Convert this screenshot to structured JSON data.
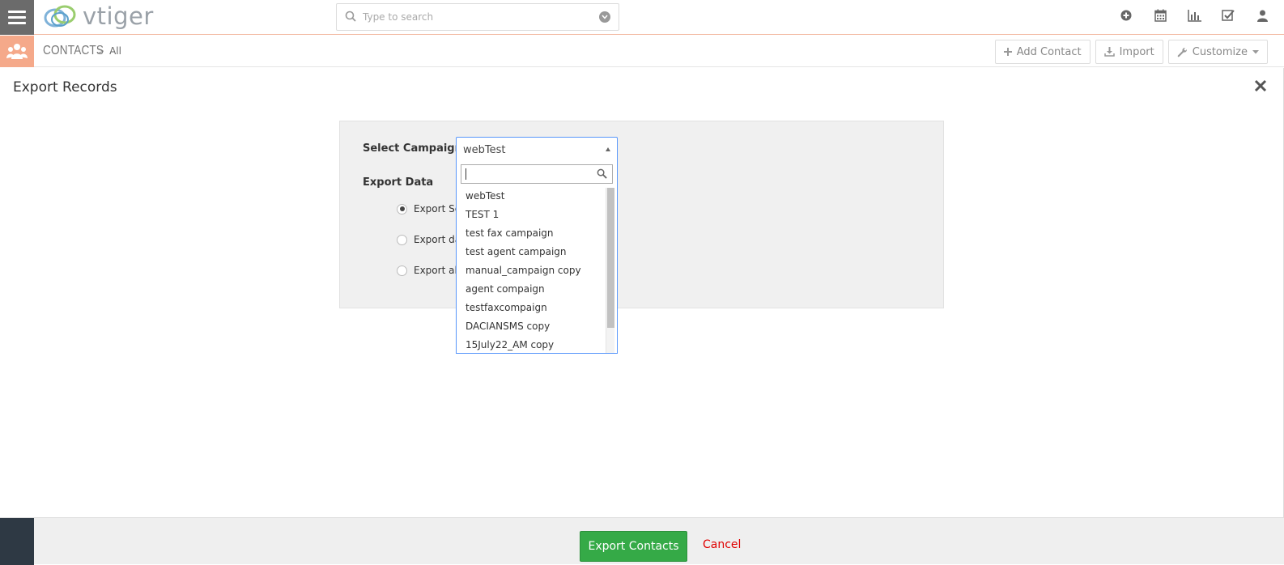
{
  "app": {
    "logo_text": "vtiger"
  },
  "search": {
    "placeholder": "Type to search"
  },
  "top_icons": [
    "plus-circle-icon",
    "calendar-icon",
    "bar-chart-icon",
    "checkbox-icon",
    "user-icon"
  ],
  "module_bar": {
    "module": "CONTACTS",
    "separator": ">",
    "view": "All",
    "actions": {
      "add": "Add Contact",
      "import": "Import",
      "customize": "Customize"
    }
  },
  "modal": {
    "title": "Export Records",
    "select_campaign_label": "Select Campaign",
    "selected_campaign": "webTest",
    "export_data_label": "Export Data",
    "radio_options": [
      "Export Se",
      "Export da",
      "Export all"
    ],
    "campaign_options": [
      "webTest",
      "TEST 1",
      "test fax campaign",
      "test agent campaign",
      "manual_campaign copy",
      "agent compaign",
      "testfaxcompaign",
      "DACIANSMS copy",
      "15July22_AM copy"
    ]
  },
  "footer": {
    "export_button": "Export Contacts",
    "cancel_link": "Cancel"
  },
  "colors": {
    "accent": "#f5a98a",
    "export_green": "#35aa47",
    "cancel_red": "#e00000",
    "select_focus": "#5897fb"
  }
}
